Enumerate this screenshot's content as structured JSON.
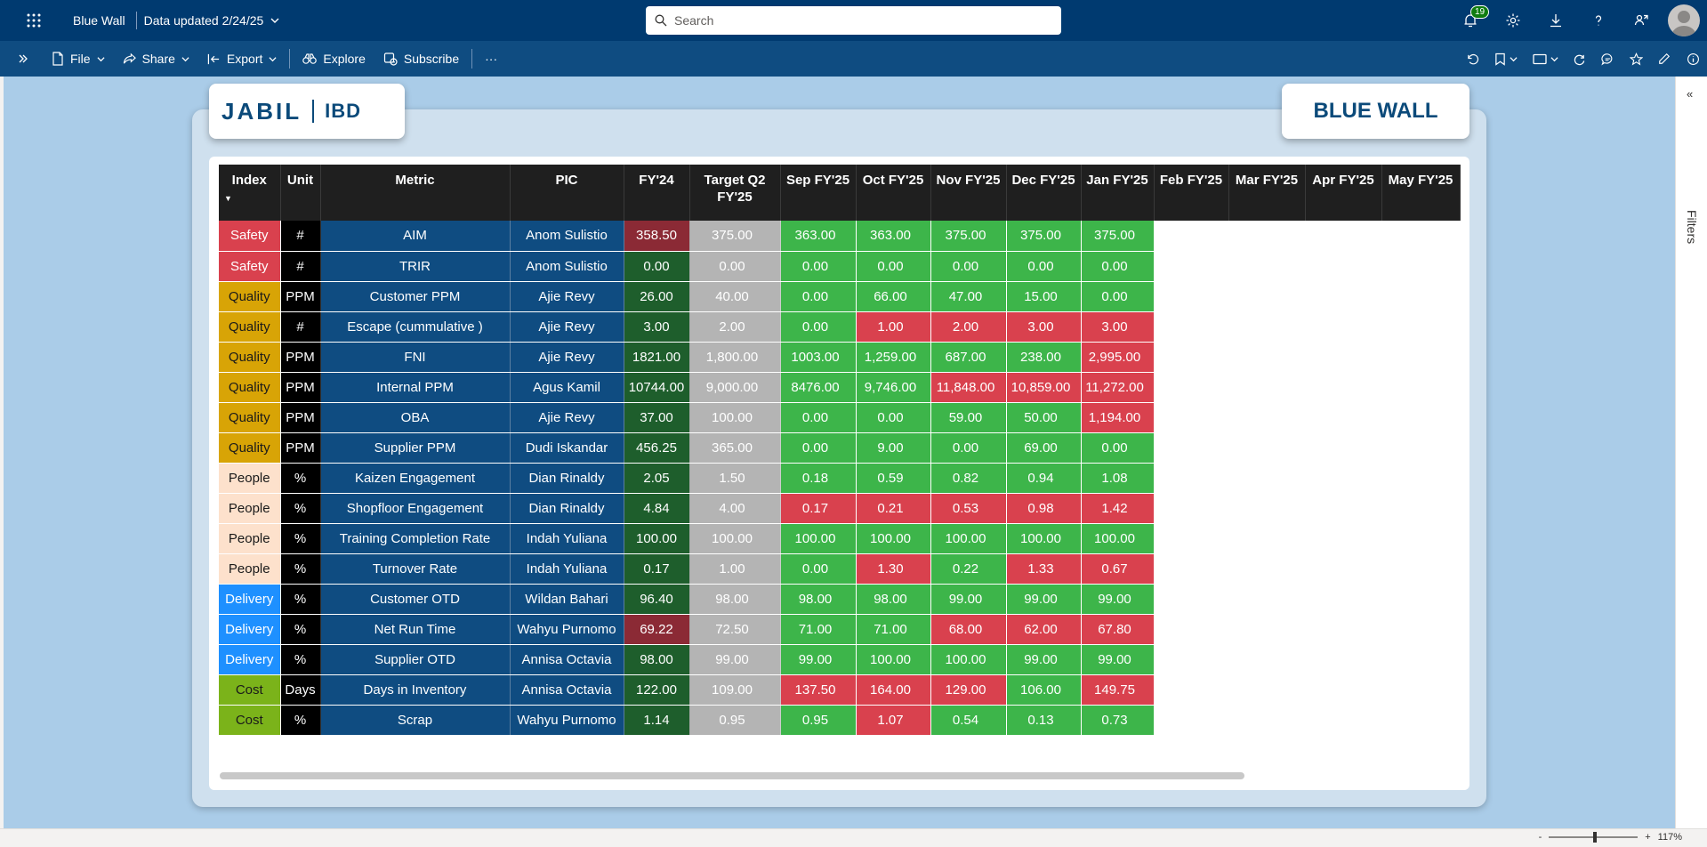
{
  "header": {
    "app_title": "Blue Wall",
    "data_updated": "Data updated 2/24/25",
    "search_placeholder": "Search",
    "notification_count": "19"
  },
  "actionbar": {
    "file": "File",
    "share": "Share",
    "export": "Export",
    "explore": "Explore",
    "subscribe": "Subscribe",
    "more": "···"
  },
  "report": {
    "logo_left": "JABIL",
    "logo_right": "IBD",
    "title": "BLUE WALL"
  },
  "filters_label": "Filters",
  "zoom_level": "117%",
  "zoom_minus": "-",
  "zoom_plus": "+",
  "table": {
    "columns": [
      "Index",
      "Unit",
      "Metric",
      "PIC",
      "FY'24",
      "Target Q2 FY'25",
      "Sep FY'25",
      "Oct FY'25",
      "Nov FY'25",
      "Dec FY'25",
      "Jan FY'25",
      "Feb FY'25",
      "Mar FY'25",
      "Apr FY'25",
      "May FY'25"
    ],
    "colors": {
      "safety": "#d9414e",
      "quality": "#d8a406",
      "people": "#fde1cc",
      "delivery": "#1e90ff",
      "cost": "#7bb31a",
      "green": "#3db54a",
      "red": "#d9414e",
      "fy_dark_green": "#1e5e2c",
      "fy_dark_red": "#8b2a35"
    },
    "rows": [
      {
        "index": "Safety",
        "unit": "#",
        "metric": "AIM",
        "pic": "Anom Sulistio",
        "fy24": "358.50",
        "fy24_status": "red",
        "target": "375.00",
        "months": [
          [
            "363.00",
            "green"
          ],
          [
            "363.00",
            "green"
          ],
          [
            "375.00",
            "green"
          ],
          [
            "375.00",
            "green"
          ],
          [
            "375.00",
            "green"
          ]
        ]
      },
      {
        "index": "Safety",
        "unit": "#",
        "metric": "TRIR",
        "pic": "Anom Sulistio",
        "fy24": "0.00",
        "fy24_status": "green",
        "target": "0.00",
        "months": [
          [
            "0.00",
            "green"
          ],
          [
            "0.00",
            "green"
          ],
          [
            "0.00",
            "green"
          ],
          [
            "0.00",
            "green"
          ],
          [
            "0.00",
            "green"
          ]
        ]
      },
      {
        "index": "Quality",
        "unit": "PPM",
        "metric": "Customer PPM",
        "pic": "Ajie Revy",
        "fy24": "26.00",
        "fy24_status": "green",
        "target": "40.00",
        "months": [
          [
            "0.00",
            "green"
          ],
          [
            "66.00",
            "green"
          ],
          [
            "47.00",
            "green"
          ],
          [
            "15.00",
            "green"
          ],
          [
            "0.00",
            "green"
          ]
        ]
      },
      {
        "index": "Quality",
        "unit": "#",
        "metric": "Escape (cummulative )",
        "pic": "Ajie Revy",
        "fy24": "3.00",
        "fy24_status": "green",
        "target": "2.00",
        "months": [
          [
            "0.00",
            "green"
          ],
          [
            "1.00",
            "red"
          ],
          [
            "2.00",
            "red"
          ],
          [
            "3.00",
            "red"
          ],
          [
            "3.00",
            "red"
          ]
        ]
      },
      {
        "index": "Quality",
        "unit": "PPM",
        "metric": "FNI",
        "pic": "Ajie Revy",
        "fy24": "1821.00",
        "fy24_status": "green",
        "target": "1,800.00",
        "months": [
          [
            "1003.00",
            "green"
          ],
          [
            "1,259.00",
            "green"
          ],
          [
            "687.00",
            "green"
          ],
          [
            "238.00",
            "green"
          ],
          [
            "2,995.00",
            "red"
          ]
        ]
      },
      {
        "index": "Quality",
        "unit": "PPM",
        "metric": "Internal PPM",
        "pic": "Agus Kamil",
        "fy24": "10744.00",
        "fy24_status": "green",
        "target": "9,000.00",
        "months": [
          [
            "8476.00",
            "green"
          ],
          [
            "9,746.00",
            "green"
          ],
          [
            "11,848.00",
            "red"
          ],
          [
            "10,859.00",
            "red"
          ],
          [
            "11,272.00",
            "red"
          ]
        ]
      },
      {
        "index": "Quality",
        "unit": "PPM",
        "metric": "OBA",
        "pic": "Ajie Revy",
        "fy24": "37.00",
        "fy24_status": "green",
        "target": "100.00",
        "months": [
          [
            "0.00",
            "green"
          ],
          [
            "0.00",
            "green"
          ],
          [
            "59.00",
            "green"
          ],
          [
            "50.00",
            "green"
          ],
          [
            "1,194.00",
            "red"
          ]
        ]
      },
      {
        "index": "Quality",
        "unit": "PPM",
        "metric": "Supplier PPM",
        "pic": "Dudi Iskandar",
        "fy24": "456.25",
        "fy24_status": "green",
        "target": "365.00",
        "months": [
          [
            "0.00",
            "green"
          ],
          [
            "9.00",
            "green"
          ],
          [
            "0.00",
            "green"
          ],
          [
            "69.00",
            "green"
          ],
          [
            "0.00",
            "green"
          ]
        ]
      },
      {
        "index": "People",
        "unit": "%",
        "metric": "Kaizen Engagement",
        "pic": "Dian Rinaldy",
        "fy24": "2.05",
        "fy24_status": "green",
        "target": "1.50",
        "months": [
          [
            "0.18",
            "green"
          ],
          [
            "0.59",
            "green"
          ],
          [
            "0.82",
            "green"
          ],
          [
            "0.94",
            "green"
          ],
          [
            "1.08",
            "green"
          ]
        ]
      },
      {
        "index": "People",
        "unit": "%",
        "metric": "Shopfloor Engagement",
        "pic": "Dian Rinaldy",
        "fy24": "4.84",
        "fy24_status": "green",
        "target": "4.00",
        "months": [
          [
            "0.17",
            "red"
          ],
          [
            "0.21",
            "red"
          ],
          [
            "0.53",
            "red"
          ],
          [
            "0.98",
            "red"
          ],
          [
            "1.42",
            "red"
          ]
        ]
      },
      {
        "index": "People",
        "unit": "%",
        "metric": "Training Completion Rate",
        "pic": "Indah Yuliana",
        "fy24": "100.00",
        "fy24_status": "green",
        "target": "100.00",
        "months": [
          [
            "100.00",
            "green"
          ],
          [
            "100.00",
            "green"
          ],
          [
            "100.00",
            "green"
          ],
          [
            "100.00",
            "green"
          ],
          [
            "100.00",
            "green"
          ]
        ]
      },
      {
        "index": "People",
        "unit": "%",
        "metric": "Turnover Rate",
        "pic": "Indah Yuliana",
        "fy24": "0.17",
        "fy24_status": "green",
        "target": "1.00",
        "months": [
          [
            "0.00",
            "green"
          ],
          [
            "1.30",
            "red"
          ],
          [
            "0.22",
            "green"
          ],
          [
            "1.33",
            "red"
          ],
          [
            "0.67",
            "red"
          ]
        ]
      },
      {
        "index": "Delivery",
        "unit": "%",
        "metric": "Customer OTD",
        "pic": "Wildan Bahari",
        "fy24": "96.40",
        "fy24_status": "green",
        "target": "98.00",
        "months": [
          [
            "98.00",
            "green"
          ],
          [
            "98.00",
            "green"
          ],
          [
            "99.00",
            "green"
          ],
          [
            "99.00",
            "green"
          ],
          [
            "99.00",
            "green"
          ]
        ]
      },
      {
        "index": "Delivery",
        "unit": "%",
        "metric": "Net Run Time",
        "pic": "Wahyu Purnomo",
        "fy24": "69.22",
        "fy24_status": "red",
        "target": "72.50",
        "months": [
          [
            "71.00",
            "green"
          ],
          [
            "71.00",
            "green"
          ],
          [
            "68.00",
            "red"
          ],
          [
            "62.00",
            "red"
          ],
          [
            "67.80",
            "red"
          ]
        ]
      },
      {
        "index": "Delivery",
        "unit": "%",
        "metric": "Supplier OTD",
        "pic": "Annisa Octavia",
        "fy24": "98.00",
        "fy24_status": "green",
        "target": "99.00",
        "months": [
          [
            "99.00",
            "green"
          ],
          [
            "100.00",
            "green"
          ],
          [
            "100.00",
            "green"
          ],
          [
            "99.00",
            "green"
          ],
          [
            "99.00",
            "green"
          ]
        ]
      },
      {
        "index": "Cost",
        "unit": "Days",
        "metric": "Days in Inventory",
        "pic": "Annisa Octavia",
        "fy24": "122.00",
        "fy24_status": "green",
        "target": "109.00",
        "months": [
          [
            "137.50",
            "red"
          ],
          [
            "164.00",
            "red"
          ],
          [
            "129.00",
            "red"
          ],
          [
            "106.00",
            "green"
          ],
          [
            "149.75",
            "red"
          ]
        ]
      },
      {
        "index": "Cost",
        "unit": "%",
        "metric": "Scrap",
        "pic": "Wahyu Purnomo",
        "fy24": "1.14",
        "fy24_status": "green",
        "target": "0.95",
        "months": [
          [
            "0.95",
            "green"
          ],
          [
            "1.07",
            "red"
          ],
          [
            "0.54",
            "green"
          ],
          [
            "0.13",
            "green"
          ],
          [
            "0.73",
            "green"
          ]
        ]
      }
    ]
  }
}
